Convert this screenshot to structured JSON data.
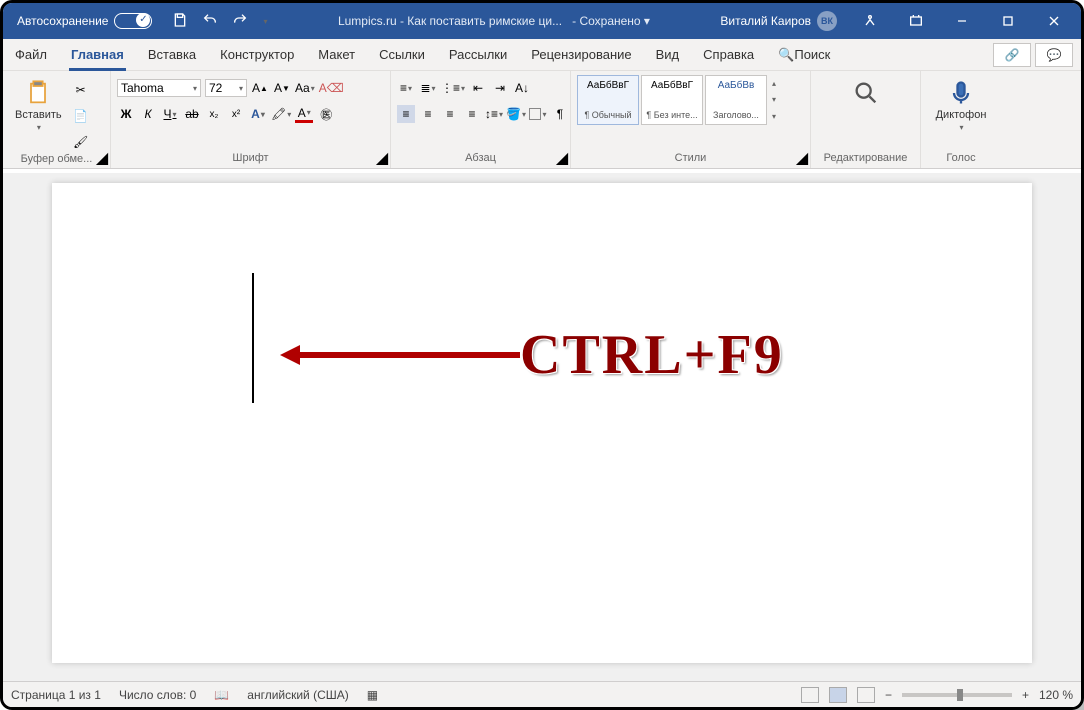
{
  "titlebar": {
    "autosave": "Автосохранение",
    "filename": "Lumpics.ru - Как поставить римские ци...",
    "saved": "Сохранено",
    "user": "Виталий Каиров",
    "user_initials": "ВК"
  },
  "tabs": {
    "file": "Файл",
    "home": "Главная",
    "insert": "Вставка",
    "design": "Конструктор",
    "layout": "Макет",
    "refs": "Ссылки",
    "mail": "Рассылки",
    "review": "Рецензирование",
    "view": "Вид",
    "help": "Справка",
    "search": "Поиск"
  },
  "ribbon": {
    "clipboard": {
      "label": "Буфер обме...",
      "paste": "Вставить"
    },
    "font": {
      "label": "Шрифт",
      "name": "Tahoma",
      "size": "72"
    },
    "para": {
      "label": "Абзац"
    },
    "styles": {
      "label": "Стили",
      "s1": "АаБбВвГ",
      "s2": "АаБбВвГ",
      "s3": "АаБбВв",
      "n1": "¶ Обычный",
      "n2": "¶ Без инте...",
      "n3": "Заголово..."
    },
    "editing": {
      "label": "Редактирование"
    },
    "voice": {
      "label": "Голос",
      "dict": "Диктофон"
    }
  },
  "annotation": "CTRL+F9",
  "status": {
    "page": "Страница 1 из 1",
    "words": "Число слов: 0",
    "lang": "английский (США)",
    "zoom": "120 %"
  }
}
